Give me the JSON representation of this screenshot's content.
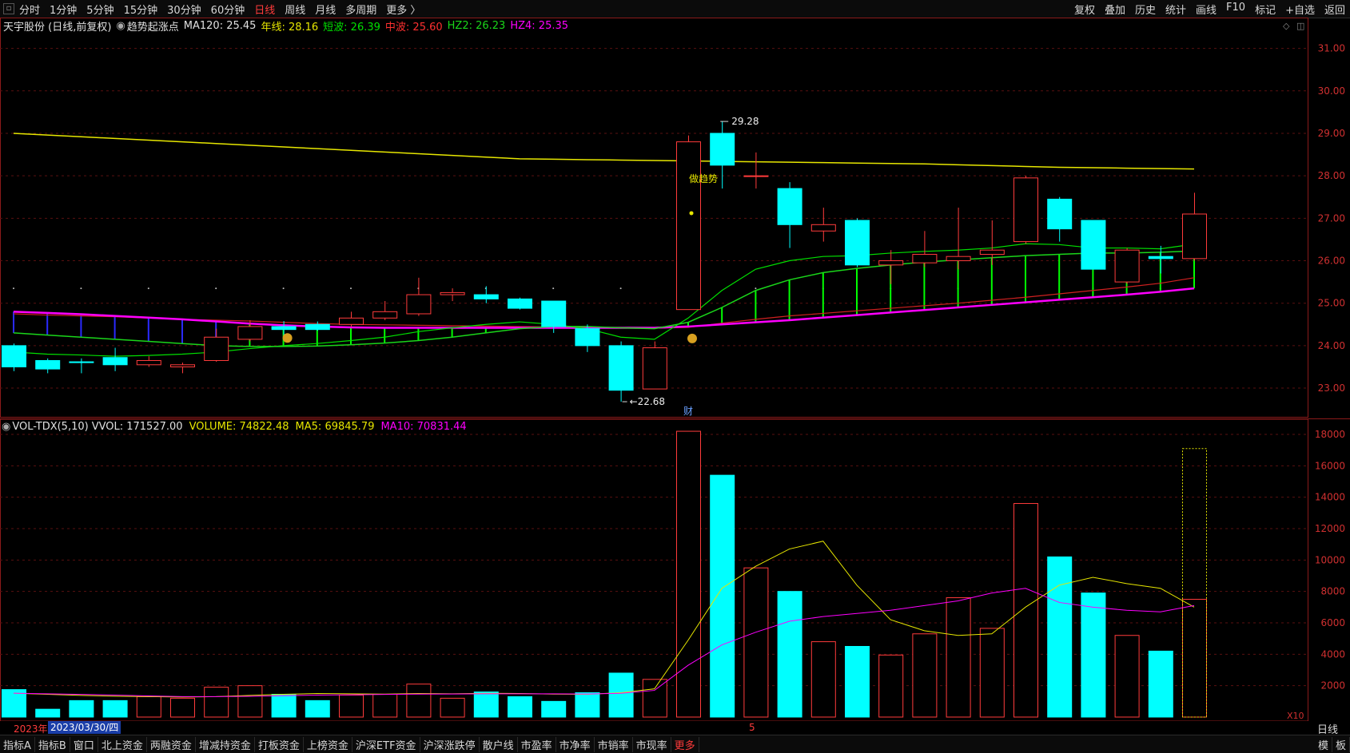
{
  "toolbar": {
    "periods": [
      "分时",
      "1分钟",
      "5分钟",
      "15分钟",
      "30分钟",
      "60分钟",
      "日线",
      "周线",
      "月线",
      "多周期",
      "更多 〉"
    ],
    "active_period": "日线",
    "right_items": [
      "复权",
      "叠加",
      "历史",
      "统计",
      "画线",
      "F10",
      "标记",
      "+自选",
      "返回"
    ]
  },
  "info": {
    "stock": "天宇股份 (日线,前复权)",
    "indicator": "趋势起涨点",
    "ma120": "MA120: 25.45",
    "nianxian": "年线: 28.16",
    "duanbo": "短波: 26.39",
    "zhongbo": "中波: 25.60",
    "hz2": "HZ2: 26.23",
    "hz4": "HZ4: 25.35"
  },
  "volume_info": {
    "name": "VOL-TDX(5,10)",
    "vvol": "VVOL: 171527.00",
    "volume": "VOLUME: 74822.48",
    "ma5": "MA5: 69845.79",
    "ma10": "MA10: 70831.44"
  },
  "annotations": {
    "high": "29.28",
    "low": "22.68",
    "trend": "做趋势",
    "cai": "财",
    "x10": "X10"
  },
  "bottom": {
    "tabs": [
      "指标A",
      "指标B",
      "窗口",
      "北上资金",
      "两融资金",
      "增减持资金",
      "打板资金",
      "上榜资金",
      "沪深ETF资金",
      "沪深涨跌停",
      "散户线",
      "市盈率",
      "市净率",
      "市销率",
      "市现率",
      "更多"
    ],
    "right": [
      "模",
      "板"
    ]
  },
  "datestrip": {
    "year": "2023年",
    "date": "2023/03/30/四",
    "month_mark": "5",
    "period": "日线"
  },
  "colors": {
    "up": "#ff3b3b",
    "down": "#00ffff",
    "year_line": "#e6e600",
    "short": "#00e000",
    "mid": "#d02020",
    "hz2": "#1ad61a",
    "hz4": "#ff00ff",
    "ma5": "#e6e600",
    "ma10": "#ff00ff",
    "blue_band": "#2a2aff"
  },
  "chart_data": {
    "type": "candlestick",
    "price_axis": {
      "ylim": [
        22.7,
        31.35
      ],
      "ticks": [
        23,
        24,
        25,
        26,
        27,
        28,
        29,
        30,
        31
      ]
    },
    "volume_axis": {
      "ylim": [
        0,
        18000
      ],
      "ticks": [
        2000,
        4000,
        6000,
        8000,
        10000,
        12000,
        14000,
        16000,
        18000
      ]
    },
    "candles": [
      {
        "o": 24.0,
        "h": 24.05,
        "l": 23.4,
        "c": 23.5
      },
      {
        "o": 23.65,
        "h": 23.7,
        "l": 23.35,
        "c": 23.45
      },
      {
        "o": 23.62,
        "h": 23.7,
        "l": 23.35,
        "c": 23.6
      },
      {
        "o": 23.72,
        "h": 23.95,
        "l": 23.4,
        "c": 23.55
      },
      {
        "o": 23.55,
        "h": 23.75,
        "l": 23.5,
        "c": 23.65
      },
      {
        "o": 23.5,
        "h": 23.6,
        "l": 23.35,
        "c": 23.55
      },
      {
        "o": 23.65,
        "h": 24.4,
        "l": 23.62,
        "c": 24.2
      },
      {
        "o": 24.15,
        "h": 24.6,
        "l": 24.1,
        "c": 24.45
      },
      {
        "o": 24.45,
        "h": 24.58,
        "l": 24.2,
        "c": 24.38
      },
      {
        "o": 24.5,
        "h": 24.57,
        "l": 24.35,
        "c": 24.38
      },
      {
        "o": 24.5,
        "h": 24.8,
        "l": 24.45,
        "c": 24.65
      },
      {
        "o": 24.65,
        "h": 25.05,
        "l": 24.6,
        "c": 24.8
      },
      {
        "o": 24.75,
        "h": 25.6,
        "l": 24.7,
        "c": 25.2
      },
      {
        "o": 25.2,
        "h": 25.35,
        "l": 25.05,
        "c": 25.25
      },
      {
        "o": 25.2,
        "h": 25.4,
        "l": 25.0,
        "c": 25.1
      },
      {
        "o": 25.1,
        "h": 25.13,
        "l": 24.85,
        "c": 24.88
      },
      {
        "o": 25.05,
        "h": 25.05,
        "l": 24.3,
        "c": 24.45
      },
      {
        "o": 24.4,
        "h": 24.5,
        "l": 23.85,
        "c": 24.0
      },
      {
        "o": 24.0,
        "h": 24.1,
        "l": 22.68,
        "c": 22.95
      },
      {
        "o": 22.98,
        "h": 24.1,
        "l": 22.98,
        "c": 23.95
      },
      {
        "o": 24.85,
        "h": 28.95,
        "l": 24.85,
        "c": 28.8
      },
      {
        "o": 29.0,
        "h": 29.28,
        "l": 27.7,
        "c": 28.25
      },
      {
        "o": 28.0,
        "h": 28.55,
        "l": 27.7,
        "c": 28.0
      },
      {
        "o": 27.7,
        "h": 27.85,
        "l": 26.3,
        "c": 26.85
      },
      {
        "o": 26.7,
        "h": 27.25,
        "l": 26.45,
        "c": 26.85
      },
      {
        "o": 26.95,
        "h": 27.0,
        "l": 25.85,
        "c": 25.9
      },
      {
        "o": 25.9,
        "h": 26.25,
        "l": 25.45,
        "c": 26.0
      },
      {
        "o": 25.95,
        "h": 26.7,
        "l": 25.85,
        "c": 26.15
      },
      {
        "o": 26.0,
        "h": 27.25,
        "l": 25.8,
        "c": 26.1
      },
      {
        "o": 26.15,
        "h": 26.95,
        "l": 25.9,
        "c": 26.25
      },
      {
        "o": 26.45,
        "h": 28.0,
        "l": 26.4,
        "c": 27.95
      },
      {
        "o": 27.45,
        "h": 27.5,
        "l": 26.45,
        "c": 26.75
      },
      {
        "o": 26.95,
        "h": 26.95,
        "l": 25.8,
        "c": 25.8
      },
      {
        "o": 25.5,
        "h": 26.3,
        "l": 25.45,
        "c": 26.25
      },
      {
        "o": 26.1,
        "h": 26.35,
        "l": 25.7,
        "c": 26.05
      },
      {
        "o": 26.05,
        "h": 27.6,
        "l": 26.0,
        "c": 27.1
      }
    ],
    "volume": [
      1750,
      500,
      1050,
      1050,
      1300,
      1200,
      1900,
      2000,
      1450,
      1050,
      1400,
      1450,
      2100,
      1200,
      1600,
      1300,
      1000,
      1550,
      2800,
      2400,
      18200,
      15400,
      9500,
      8000,
      4800,
      4500,
      3950,
      5300,
      7600,
      5650,
      13600,
      10200,
      7900,
      5200,
      4200,
      7500
    ],
    "volume_ghost_last": 17100,
    "ma5": [
      1520,
      1450,
      1380,
      1330,
      1300,
      1280,
      1300,
      1380,
      1450,
      1500,
      1480,
      1460,
      1500,
      1480,
      1510,
      1500,
      1460,
      1450,
      1550,
      1800,
      4900,
      8200,
      9600,
      10700,
      11200,
      8400,
      6200,
      5500,
      5200,
      5300,
      7000,
      8400,
      8900,
      8500,
      8200,
      7000
    ],
    "ma10": [
      1520,
      1480,
      1440,
      1400,
      1350,
      1300,
      1300,
      1320,
      1360,
      1400,
      1420,
      1440,
      1460,
      1470,
      1480,
      1480,
      1480,
      1470,
      1510,
      1700,
      3300,
      4600,
      5400,
      6100,
      6400,
      6600,
      6800,
      7100,
      7400,
      7900,
      8200,
      7300,
      7000,
      6800,
      6700,
      7100
    ],
    "year_line": [
      29.0,
      28.96,
      28.92,
      28.88,
      28.84,
      28.8,
      28.76,
      28.72,
      28.68,
      28.64,
      28.6,
      28.56,
      28.52,
      28.48,
      28.44,
      28.4,
      28.39,
      28.38,
      28.37,
      28.36,
      28.35,
      28.34,
      28.33,
      28.32,
      28.31,
      28.3,
      28.29,
      28.28,
      28.26,
      28.24,
      28.22,
      28.2,
      28.19,
      28.18,
      28.17,
      28.16
    ],
    "short_wave": [
      23.85,
      23.8,
      23.78,
      23.75,
      23.77,
      23.8,
      23.85,
      23.93,
      24.0,
      24.05,
      24.12,
      24.2,
      24.33,
      24.42,
      24.5,
      24.56,
      24.5,
      24.4,
      24.2,
      24.15,
      24.65,
      25.3,
      25.8,
      26.0,
      26.1,
      26.12,
      26.18,
      26.22,
      26.25,
      26.3,
      26.4,
      26.38,
      26.3,
      26.3,
      26.28,
      26.39
    ],
    "mid_wave": [
      24.75,
      24.72,
      24.7,
      24.68,
      24.65,
      24.62,
      24.6,
      24.58,
      24.55,
      24.52,
      24.5,
      24.49,
      24.48,
      24.47,
      24.46,
      24.45,
      24.44,
      24.43,
      24.42,
      24.41,
      24.43,
      24.53,
      24.62,
      24.7,
      24.76,
      24.82,
      24.88,
      24.94,
      25.0,
      25.07,
      25.14,
      25.22,
      25.3,
      25.38,
      25.47,
      25.6
    ],
    "hz2": [
      24.3,
      24.25,
      24.2,
      24.15,
      24.1,
      24.05,
      24.0,
      23.98,
      23.98,
      23.99,
      24.02,
      24.06,
      24.12,
      24.2,
      24.3,
      24.4,
      24.45,
      24.45,
      24.42,
      24.4,
      24.55,
      24.9,
      25.3,
      25.55,
      25.72,
      25.82,
      25.9,
      25.97,
      26.02,
      26.07,
      26.12,
      26.15,
      26.18,
      26.18,
      26.2,
      26.23
    ],
    "hz4": [
      24.8,
      24.77,
      24.74,
      24.7,
      24.66,
      24.62,
      24.57,
      24.52,
      24.48,
      24.45,
      24.43,
      24.42,
      24.42,
      24.42,
      24.42,
      24.42,
      24.42,
      24.42,
      24.42,
      24.42,
      24.45,
      24.5,
      24.55,
      24.6,
      24.66,
      24.72,
      24.78,
      24.84,
      24.9,
      24.96,
      25.02,
      25.08,
      25.14,
      25.2,
      25.27,
      25.35
    ]
  }
}
